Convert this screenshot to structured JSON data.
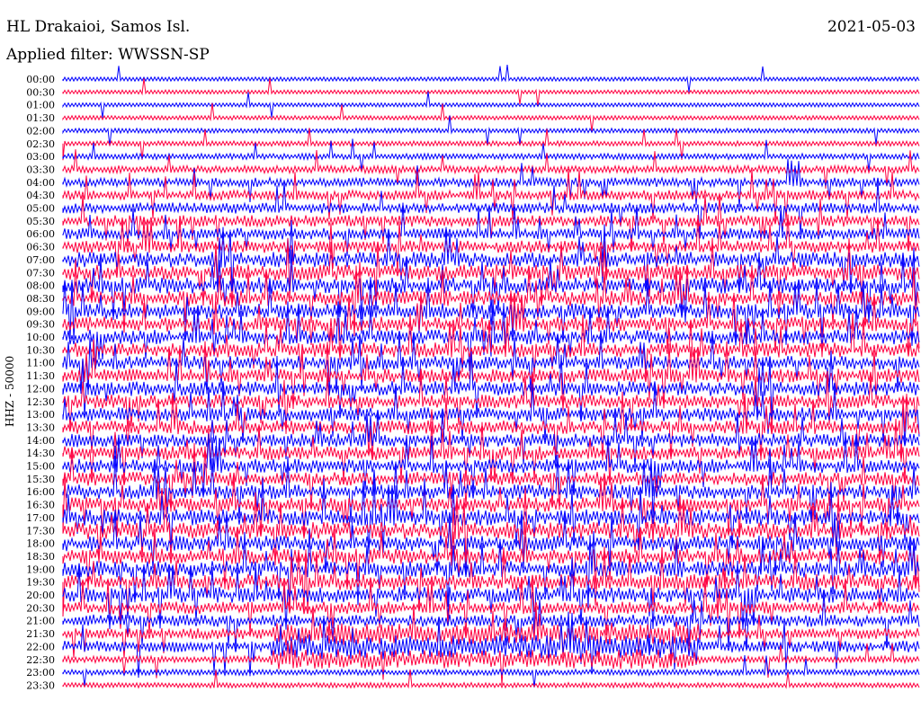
{
  "header": {
    "station": "HL Drakaioi, Samos Isl.",
    "filter": "Applied filter: WWSSN-SP",
    "date": "2021-05-03"
  },
  "chart_data": {
    "type": "line",
    "subtype": "helicorder",
    "title": "HL Drakaioi, Samos Isl.",
    "ylabel": "HHZ - 50000",
    "tick_labels": [
      "00:00",
      "00:30",
      "01:00",
      "01:30",
      "02:00",
      "02:30",
      "03:00",
      "03:30",
      "04:00",
      "04:30",
      "05:00",
      "05:30",
      "06:00",
      "06:30",
      "07:00",
      "07:30",
      "08:00",
      "08:30",
      "09:00",
      "09:30",
      "10:00",
      "10:30",
      "11:00",
      "11:30",
      "12:00",
      "12:30",
      "13:00",
      "13:30",
      "14:00",
      "14:30",
      "15:00",
      "15:30",
      "16:00",
      "16:30",
      "17:00",
      "17:30",
      "18:00",
      "18:30",
      "19:00",
      "19:30",
      "20:00",
      "20:30",
      "21:00",
      "21:30",
      "22:00",
      "22:30",
      "23:00",
      "23:30"
    ],
    "trace_colors": [
      "#0000ff",
      "#ff0040"
    ],
    "grid": false,
    "series": [
      {
        "amplitude": [
          0.08,
          0.08,
          0.08,
          0.1,
          0.12,
          0.15,
          0.2,
          0.3,
          0.4,
          0.45,
          0.5,
          0.55,
          0.55,
          0.6,
          0.8,
          0.85,
          0.85,
          0.8,
          0.8,
          0.75,
          0.75,
          0.75,
          0.7,
          0.7,
          0.75,
          0.7,
          0.7,
          0.7,
          0.7,
          0.7,
          0.7,
          0.7,
          0.75,
          0.75,
          0.85,
          0.9,
          0.8,
          0.8,
          0.85,
          0.85,
          0.8,
          0.6,
          0.6,
          0.5,
          0.55,
          0.25,
          0.2,
          0.15
        ]
      }
    ]
  }
}
